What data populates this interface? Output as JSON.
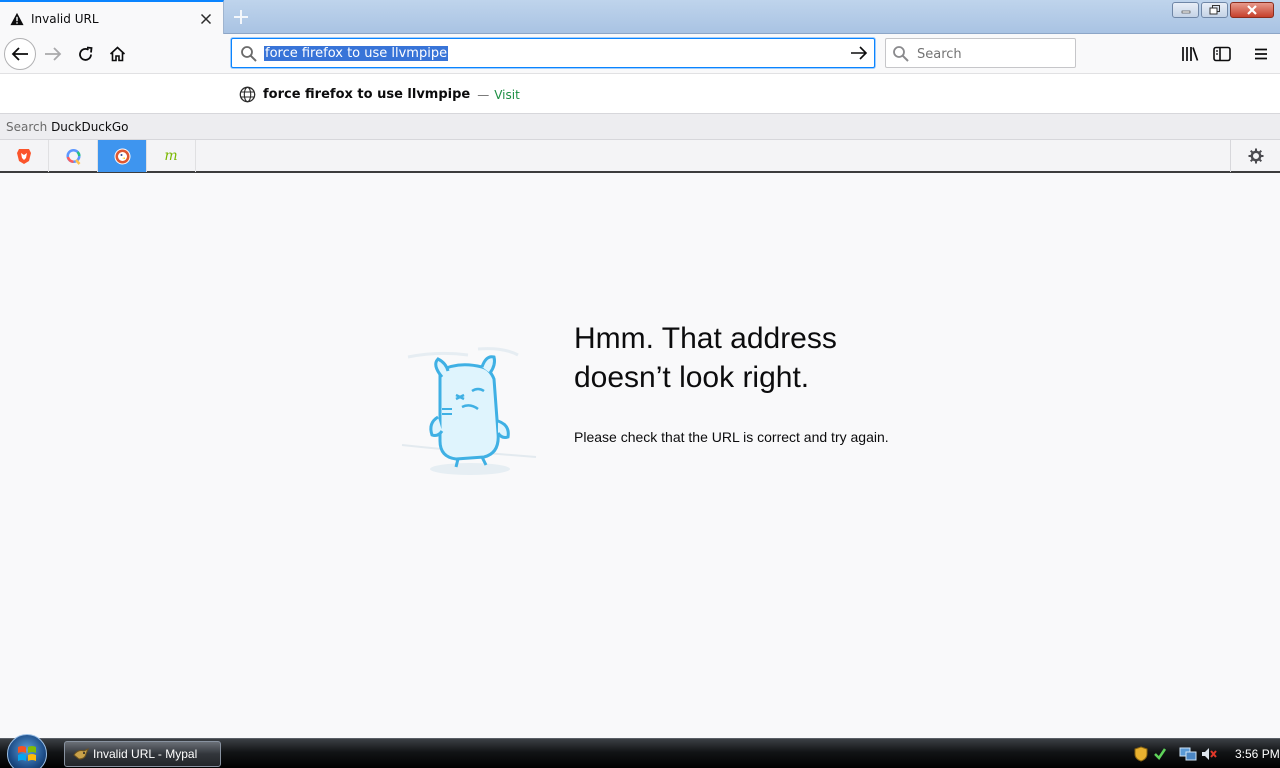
{
  "tab": {
    "title": "Invalid URL",
    "icon": "warning-icon"
  },
  "urlbar": {
    "value": "force firefox to use llvmpipe"
  },
  "searchbar": {
    "placeholder": "Search"
  },
  "dropdown": {
    "suggestion": "force firefox to use llvmpipe",
    "separator": "—",
    "action": "Visit",
    "search_prefix": "Search",
    "search_engine": "DuckDuckGo"
  },
  "engines": [
    {
      "name": "brave-icon"
    },
    {
      "name": "qwant-icon"
    },
    {
      "name": "duckduckgo-icon",
      "selected": true
    },
    {
      "name": "mojeek-icon",
      "glyph": "m"
    }
  ],
  "error": {
    "title_line1": "Hmm. That address",
    "title_line2": "doesn’t look right.",
    "description": "Please check that the URL is correct and try again."
  },
  "taskbar": {
    "app_label": "Invalid URL - Mypal",
    "clock": "3:56 PM"
  },
  "colors": {
    "accent": "#0a84ff",
    "selection": "#3874d8",
    "visit": "#1c8e43",
    "engine_selected": "#3e95ef"
  }
}
